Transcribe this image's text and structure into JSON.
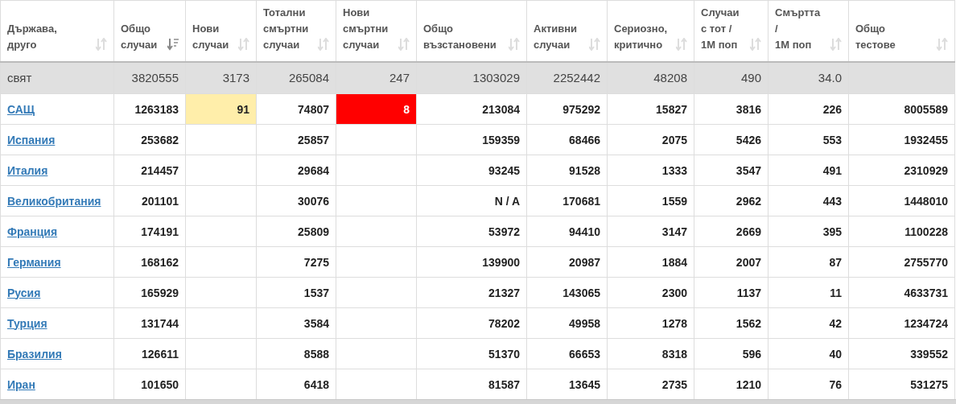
{
  "table": {
    "columns": [
      {
        "lines": [
          "Държава,",
          "друго"
        ],
        "sorted": false
      },
      {
        "lines": [
          "Общо",
          "случаи"
        ],
        "sorted": true
      },
      {
        "lines": [
          "Нови",
          "случаи"
        ],
        "sorted": false
      },
      {
        "lines": [
          "Тотални",
          "смъртни",
          "случаи"
        ],
        "sorted": false
      },
      {
        "lines": [
          "Нови",
          "смъртни",
          "случаи"
        ],
        "sorted": false
      },
      {
        "lines": [
          "Общо",
          "възстановени"
        ],
        "sorted": false
      },
      {
        "lines": [
          "Активни",
          "случаи"
        ],
        "sorted": false
      },
      {
        "lines": [
          "Сериозно,",
          "критично"
        ],
        "sorted": false
      },
      {
        "lines": [
          "Случаи",
          "с тот /",
          "1М поп"
        ],
        "sorted": false
      },
      {
        "lines": [
          "Смъртта",
          "/",
          "1М поп"
        ],
        "sorted": false
      },
      {
        "lines": [
          "Общо",
          "тестове"
        ],
        "sorted": false
      }
    ],
    "rows": [
      {
        "kind": "total",
        "cells": [
          "свят",
          "3820555",
          "3173",
          "265084",
          "247",
          "1303029",
          "2252442",
          "48208",
          "490",
          "34.0",
          null
        ]
      },
      {
        "kind": "country",
        "cells": [
          "САЩ",
          "1263183",
          {
            "text": "91",
            "color": "#ffeeaa"
          },
          "74807",
          {
            "text": "8",
            "color": "#ff0000"
          },
          "213084",
          "975292",
          "15827",
          "3816",
          "226",
          "8005589"
        ]
      },
      {
        "kind": "country",
        "cells": [
          "Испания",
          "253682",
          null,
          "25857",
          null,
          "159359",
          "68466",
          "2075",
          "5426",
          "553",
          "1932455"
        ]
      },
      {
        "kind": "country",
        "cells": [
          "Италия",
          "214457",
          null,
          "29684",
          null,
          "93245",
          "91528",
          "1333",
          "3547",
          "491",
          "2310929"
        ]
      },
      {
        "kind": "country",
        "cells": [
          "Великобритания",
          "201101",
          null,
          "30076",
          null,
          "N / A",
          "170681",
          "1559",
          "2962",
          "443",
          "1448010"
        ]
      },
      {
        "kind": "country",
        "cells": [
          "Франция",
          "174191",
          null,
          "25809",
          null,
          "53972",
          "94410",
          "3147",
          "2669",
          "395",
          "1100228"
        ]
      },
      {
        "kind": "country",
        "cells": [
          "Германия",
          "168162",
          null,
          "7275",
          null,
          "139900",
          "20987",
          "1884",
          "2007",
          "87",
          "2755770"
        ]
      },
      {
        "kind": "country",
        "cells": [
          "Русия",
          "165929",
          null,
          "1537",
          null,
          "21327",
          "143065",
          "2300",
          "1137",
          "11",
          "4633731"
        ]
      },
      {
        "kind": "country",
        "cells": [
          "Турция",
          "131744",
          null,
          "3584",
          null,
          "78202",
          "49958",
          "1278",
          "1562",
          "42",
          "1234724"
        ]
      },
      {
        "kind": "country",
        "cells": [
          "Бразилия",
          "126611",
          null,
          "8588",
          null,
          "51370",
          "66653",
          "8318",
          "596",
          "40",
          "339552"
        ]
      },
      {
        "kind": "country",
        "cells": [
          "Иран",
          "101650",
          null,
          "6418",
          null,
          "81587",
          "13645",
          "2735",
          "1210",
          "76",
          "531275"
        ]
      }
    ]
  }
}
